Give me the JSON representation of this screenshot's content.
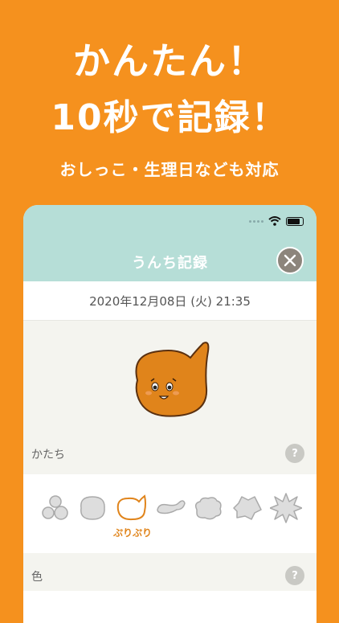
{
  "promo": {
    "line1": "かんたん！",
    "line2": "10秒で記録！",
    "line3": "おしっこ・生理日なども対応"
  },
  "screen": {
    "title": "うんち記録",
    "datetime": "2020年12月08日 (火) 21:35",
    "sections": {
      "shape_label": "かたち",
      "color_label": "色",
      "help_symbol": "?"
    },
    "shapes": [
      {
        "name": "korokoro",
        "icon": "pebbles-icon"
      },
      {
        "name": "katai",
        "icon": "round-blob-icon"
      },
      {
        "name": "puripuri",
        "icon": "mascot-outline-icon",
        "selected": true
      },
      {
        "name": "yawaraka",
        "icon": "sperm-shape-icon"
      },
      {
        "name": "doro",
        "icon": "cloud-blob-icon"
      },
      {
        "name": "bechabecha",
        "icon": "splat-icon"
      },
      {
        "name": "shabashaba",
        "icon": "burst-icon"
      }
    ],
    "selected_caption": "ぷりぷり"
  },
  "colors": {
    "background": "#F5911E",
    "header": "#B6DED7",
    "accent": "#E0841B",
    "mascot_body": "#E0841B"
  }
}
